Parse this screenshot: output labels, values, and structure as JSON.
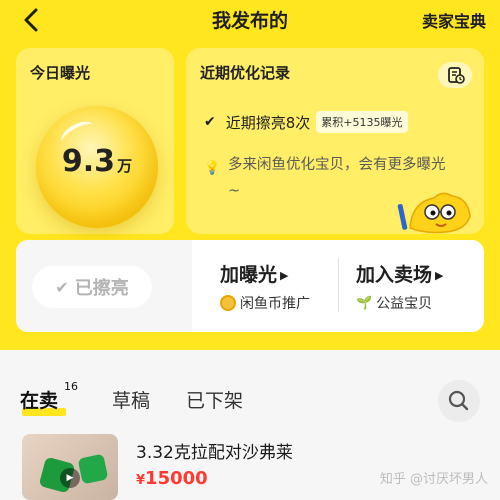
{
  "header": {
    "title": "我发布的",
    "right_link": "卖家宝典"
  },
  "today": {
    "label": "今日曝光",
    "value": "9.3",
    "unit": "万"
  },
  "optimize": {
    "title": "近期优化记录",
    "record_text": "近期擦亮8次",
    "record_badge": "累积+5135曝光",
    "tip": "多来闲鱼优化宝贝，会有更多曝光~"
  },
  "actions": {
    "polished_label": "已擦亮",
    "options": [
      {
        "title": "加曝光",
        "sub": "闲鱼币推广"
      },
      {
        "title": "加入卖场",
        "sub": "公益宝贝"
      }
    ]
  },
  "tabs": [
    {
      "label": "在卖",
      "count": "16"
    },
    {
      "label": "草稿"
    },
    {
      "label": "已下架"
    }
  ],
  "item": {
    "title": "3.32克拉配对沙弗莱",
    "currency": "¥",
    "price": "15000"
  },
  "watermark": "知乎 @讨厌坏男人",
  "colors": {
    "brand_yellow": "#ffe61e",
    "price_red": "#ff3b30"
  },
  "icons": [
    "back-icon",
    "record-icon",
    "check-icon",
    "bulb-icon",
    "mascot-icon",
    "coin-icon",
    "plant-icon",
    "search-icon",
    "play-icon"
  ]
}
